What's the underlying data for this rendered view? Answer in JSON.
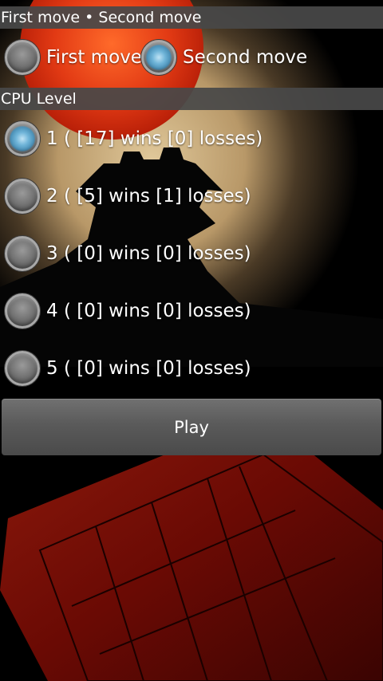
{
  "move_section": {
    "header": "First move • Second move",
    "options": [
      {
        "label": "First move",
        "checked": false
      },
      {
        "label": "Second move",
        "checked": true
      }
    ]
  },
  "cpu_section": {
    "header": "CPU Level",
    "levels": [
      {
        "label": "1 ( [17] wins [0] losses)",
        "checked": true
      },
      {
        "label": "2 ( [5] wins [1] losses)",
        "checked": false
      },
      {
        "label": "3 ( [0] wins [0] losses)",
        "checked": false
      },
      {
        "label": "4 ( [0] wins [0] losses)",
        "checked": false
      },
      {
        "label": "5 ( [0] wins [0] losses)",
        "checked": false
      }
    ]
  },
  "play_button": {
    "label": "Play"
  },
  "colors": {
    "header_bg": "#484848",
    "radio_checked": "#6fb4d8",
    "moon": "#d9361a",
    "board": "#7a0c06"
  },
  "background": {
    "elements": [
      "sky-glow",
      "red-moon",
      "castle-silhouette",
      "wooden-board"
    ]
  }
}
